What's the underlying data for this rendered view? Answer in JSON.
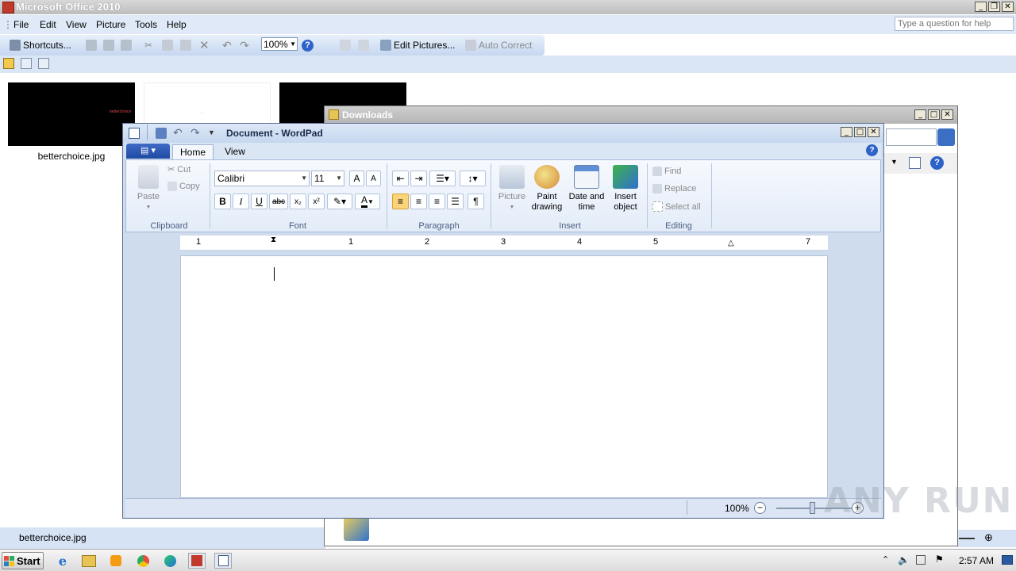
{
  "picture_manager": {
    "title": "Microsoft Office 2010",
    "menu": [
      "File",
      "Edit",
      "View",
      "Picture",
      "Tools",
      "Help"
    ],
    "help_placeholder": "Type a question for help",
    "toolbar": {
      "shortcuts_label": "Shortcuts...",
      "zoom_value": "100%",
      "edit_pictures_label": "Edit Pictures...",
      "auto_correct_label": "Auto Correct"
    },
    "thumbnail_caption": "betterchoice.jpg",
    "thumb1_text": "betterchoice",
    "thumb2_text": "...",
    "status_text": "betterchoice.jpg"
  },
  "downloads": {
    "title": "Downloads"
  },
  "wordpad": {
    "title": "Document - WordPad",
    "tabs": [
      "Home",
      "View"
    ],
    "clipboard": {
      "paste": "Paste",
      "cut": "Cut",
      "copy": "Copy",
      "group": "Clipboard"
    },
    "font": {
      "family": "Calibri",
      "size": "11",
      "group": "Font"
    },
    "paragraph": {
      "group": "Paragraph"
    },
    "insert": {
      "picture": "Picture",
      "paint1": "Paint",
      "paint2": "drawing",
      "date1": "Date and",
      "date2": "time",
      "obj1": "Insert",
      "obj2": "object",
      "group": "Insert"
    },
    "editing": {
      "find": "Find",
      "replace": "Replace",
      "select_all": "Select all",
      "group": "Editing"
    },
    "ruler_numbers": [
      "1",
      "1",
      "2",
      "3",
      "4",
      "5",
      "7"
    ],
    "zoom": "100%"
  },
  "taskbar": {
    "start_label": "Start",
    "clock": "2:57 AM"
  },
  "watermark": "ANY RUN",
  "colors": {
    "accent_blue": "#1f4aa3",
    "title_grey": "#bdbdbd",
    "menubar": "#dfe9f7"
  }
}
